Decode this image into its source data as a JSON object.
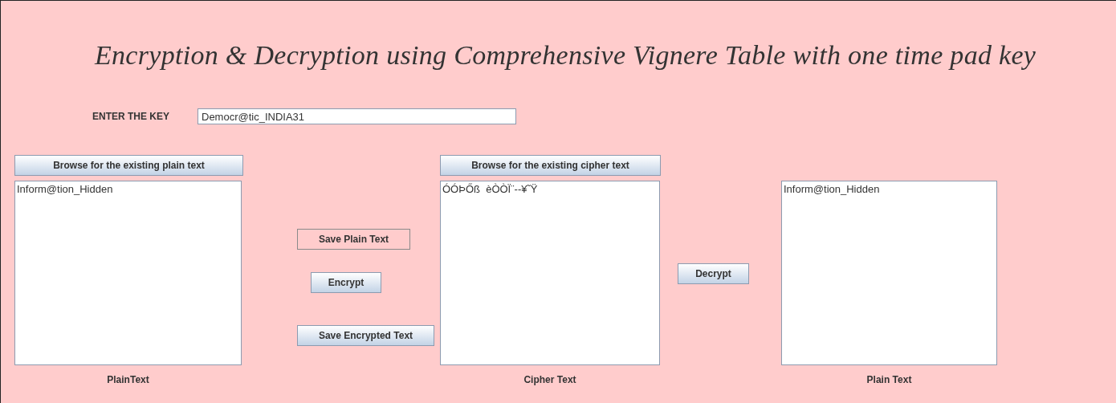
{
  "title": "Encryption & Decryption using Comprehensive Vignere Table with one time pad key",
  "key": {
    "label": "ENTER THE KEY",
    "value": "Democr@tic_INDIA31"
  },
  "plain_panel": {
    "browse_button": "Browse for the existing plain text",
    "text": "Inform@tion_Hidden",
    "caption": "PlainText"
  },
  "actions": [
    {
      "label": "Save Plain Text",
      "kind": "flat"
    },
    {
      "label": "Encrypt",
      "kind": "raised"
    },
    {
      "label": "Save Encrypted Text",
      "kind": "raised"
    }
  ],
  "cipher_panel": {
    "browse_button": "Browse for the existing cipher text",
    "text": "ÓÓÞŐß  èÒÒÏ¨--¥˜Ÿ",
    "caption": "Cipher Text"
  },
  "decrypt_button": {
    "label": "Decrypt",
    "kind": "raised"
  },
  "result_panel": {
    "text": "Inform@tion_Hidden",
    "caption": "Plain Text"
  }
}
